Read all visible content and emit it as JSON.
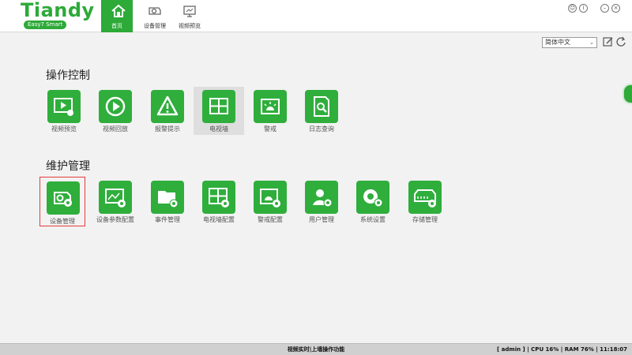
{
  "app": {
    "logo_name": "Tiandy",
    "logo_tagline": "Easy7 Smart"
  },
  "nav": {
    "items": [
      {
        "label": "首页",
        "icon": "home-icon",
        "active": true
      },
      {
        "label": "设备管理",
        "icon": "camera-icon",
        "active": false
      },
      {
        "label": "视频预览",
        "icon": "monitor-icon",
        "active": false
      }
    ]
  },
  "window_controls": [
    "user-icon",
    "info-icon",
    "minimize-icon",
    "close-icon"
  ],
  "language": {
    "selected": "简体中文"
  },
  "sections": {
    "operation": {
      "title": "操作控制",
      "tiles": [
        {
          "label": "视频预览",
          "icon": "video-preview-icon"
        },
        {
          "label": "视频回放",
          "icon": "playback-icon"
        },
        {
          "label": "报警提示",
          "icon": "alarm-warning-icon"
        },
        {
          "label": "电视墙",
          "icon": "tv-wall-icon"
        },
        {
          "label": "警戒",
          "icon": "alert-light-icon"
        },
        {
          "label": "日志查询",
          "icon": "log-search-icon"
        }
      ]
    },
    "maintenance": {
      "title": "维护管理",
      "tiles": [
        {
          "label": "设备管理",
          "icon": "device-settings-icon"
        },
        {
          "label": "设备参数配置",
          "icon": "device-params-icon"
        },
        {
          "label": "事件管理",
          "icon": "event-folder-icon"
        },
        {
          "label": "电视墙配置",
          "icon": "tv-wall-config-icon"
        },
        {
          "label": "警戒配置",
          "icon": "alert-config-icon"
        },
        {
          "label": "用户管理",
          "icon": "user-manage-icon"
        },
        {
          "label": "系统设置",
          "icon": "system-gear-icon"
        },
        {
          "label": "存储管理",
          "icon": "storage-icon"
        }
      ]
    }
  },
  "status": {
    "message": "视频实时|上墙操作功能",
    "user": "[ admin ]",
    "cpu": "CPU   16%",
    "ram": "RAM   76%",
    "time": "11:18:07"
  },
  "colors": {
    "brand_green": "#2daa38",
    "selection_red": "#e53b3b"
  }
}
